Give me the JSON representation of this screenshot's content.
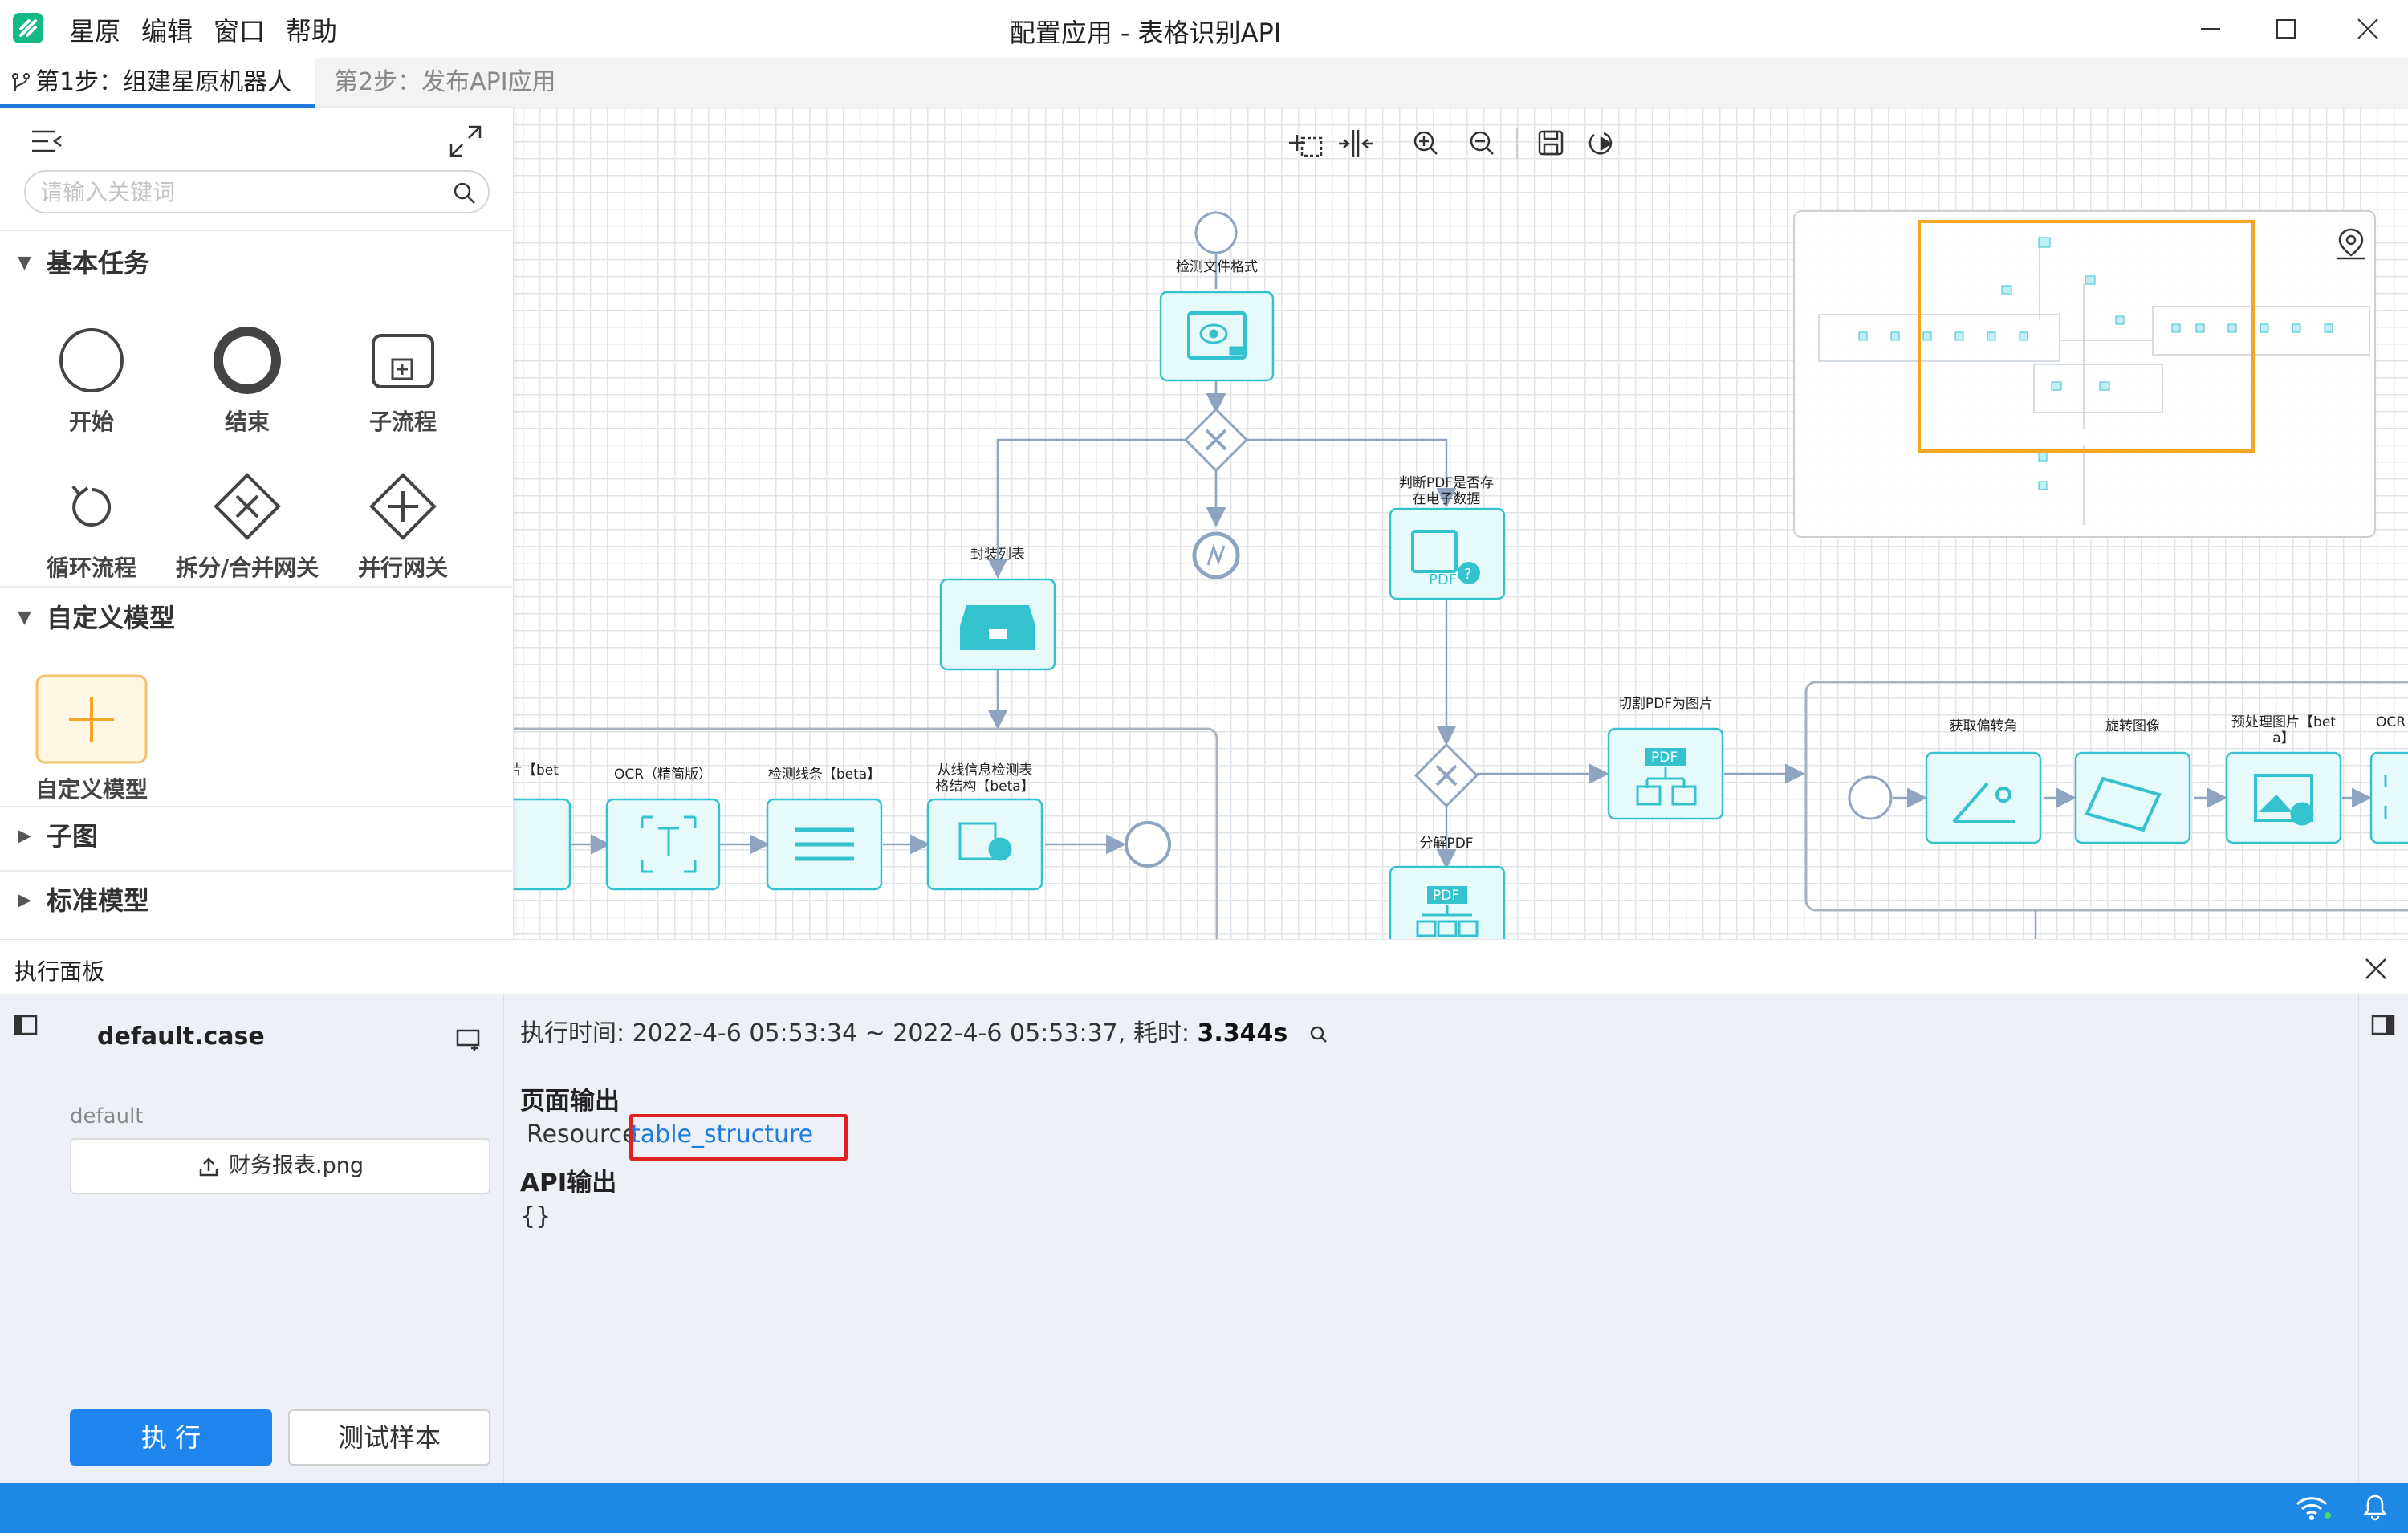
{
  "app": {
    "menu": [
      "星原",
      "编辑",
      "窗口",
      "帮助"
    ],
    "window_title": "配置应用 - 表格识别API"
  },
  "steps": {
    "step1": "第1步：组建星原机器人",
    "step2": "第2步：发布API应用"
  },
  "palette": {
    "search_placeholder": "请输入关键词",
    "basic_title": "基本任务",
    "basic_items": [
      "开始",
      "结束",
      "子流程",
      "循环流程",
      "拆分/合并网关",
      "并行网关"
    ],
    "custom_title": "自定义模型",
    "custom_item": "自定义模型",
    "subgraph_title": "子图",
    "standard_title": "标准模型"
  },
  "toolbar": {
    "icons": [
      "select-area-icon",
      "fit-width-icon",
      "zoom-in-icon",
      "zoom-out-icon",
      "save-icon",
      "run-icon"
    ]
  },
  "flow": {
    "detect_format": "检测文件格式",
    "pack_list": "封装列表",
    "judge_pdf_1": "判断PDF是否存",
    "judge_pdf_2": "在电子数据",
    "split_pdf": "分解PDF",
    "cut_pdf": "切割PDF为图片",
    "img_bet_1": "片【bet",
    "img_bet_2": "】",
    "ocr_fast": "OCR（精简版）",
    "detect_lines": "检测线条【beta】",
    "table_struct_1": "从线信息检测表",
    "table_struct_2": "格结构【beta】",
    "get_angle": "获取偏转角",
    "rotate_img": "旋转图像",
    "preprocess_1": "预处理图片【bet",
    "preprocess_2": "a】",
    "ocr_cut": "OCR"
  },
  "exec_panel": {
    "title": "执行面板",
    "case_name": "default.case",
    "case_group": "default",
    "file_name": "财务报表.png",
    "run_label": "执 行",
    "sample_label": "测试样本",
    "time_prefix": "执行时间: 2022-4-6 05:53:34 ~ 2022-4-6 05:53:37, 耗时: ",
    "time_cost": "3.344s",
    "page_output_title": "页面输出",
    "resource_label": "Resource",
    "resource_link": "table_structure",
    "api_output_title": "API输出",
    "api_output_value": "{}"
  },
  "colors": {
    "accent": "#1f86f0",
    "node_fill": "#e6f9fb",
    "node_border": "#35c2cf",
    "statusbar": "#1e88e5",
    "highlight": "#e02020"
  }
}
